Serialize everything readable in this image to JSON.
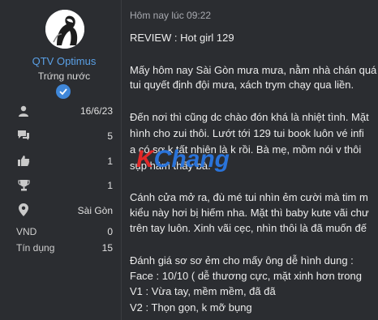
{
  "user": {
    "name": "QTV Optimus",
    "rank": "Trứng nước",
    "badge_icon": "check-badge-icon"
  },
  "stats": {
    "join_date": "16/6/23",
    "messages": "5",
    "reactions": "1",
    "points": "1",
    "location": "Sài Gòn",
    "vnd_label": "VND",
    "vnd_value": "0",
    "credit_label": "Tín dụng",
    "credit_value": "15"
  },
  "post": {
    "timestamp": "Hôm nay lúc 09:22",
    "lines": [
      "REVIEW : Hot girl 129",
      "Mấy hôm nay Sài Gòn mưa mưa, nằm nhà chán quá",
      "tui quyết định đội mưa, xách trym chạy qua liền.",
      "Đến nơi thì cũng dc chào đón khá là nhiệt tình. Mặt",
      "hình cho zui thôi. Lướt tới 129 tui book luôn vé infi",
      "a có sơ k tất nhiên là k rồi. Bà mẹ, mồm nói v thôi",
      "sụp hầm thấy bà.",
      "Cánh cửa mở ra, đù mé tui nhìn ẻm cười mà tim m",
      "kiểu này hơi bị hiếm nha. Mặt thì baby kute vãi chư",
      "trên tay luôn. Xinh vãi cẹc, nhìn thôi là đã muốn đế",
      "Đánh giá sơ sơ ẻm cho mấy ông dễ hình dung :",
      "Face : 10/10 ( dễ thương cực, mặt xinh hơn trong",
      "V1 : Vừa tay, mềm mềm, đã đã",
      "V2 : Thọn gọn, k mỡ bụng"
    ]
  },
  "watermark": {
    "k": "K",
    "rest": "Chang"
  }
}
